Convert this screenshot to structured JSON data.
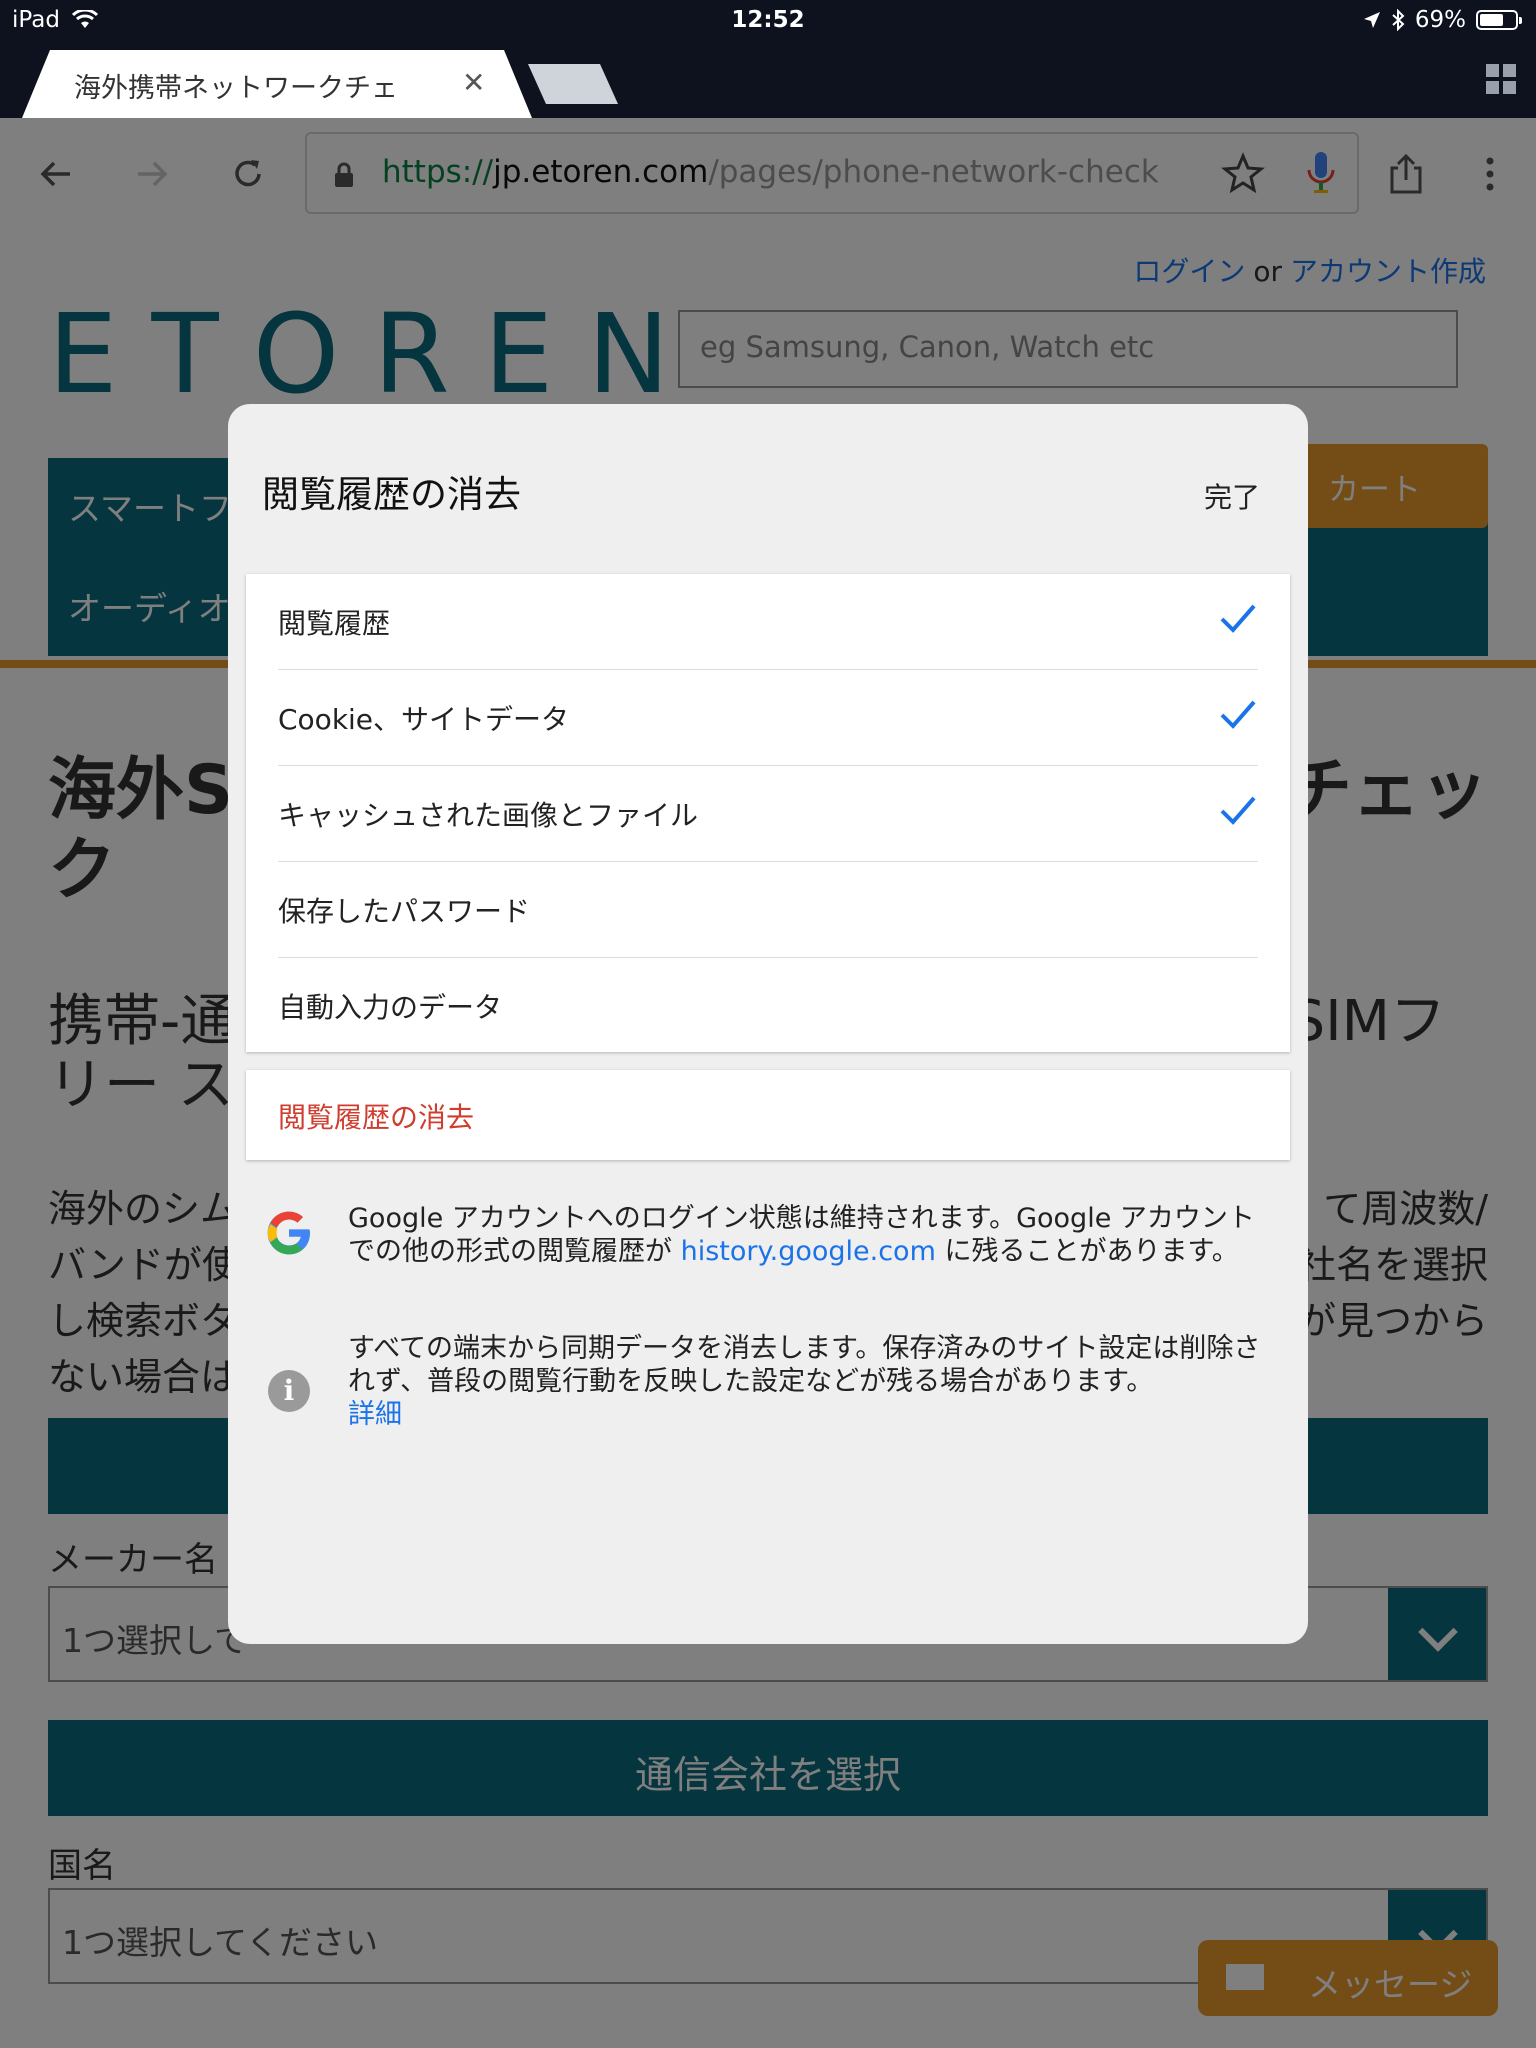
{
  "status_bar": {
    "device": "iPad",
    "time": "12:52",
    "battery": "69%",
    "battery_level": 0.69
  },
  "tab": {
    "title": "海外携帯ネットワークチェ",
    "close_glyph": "✕"
  },
  "toolbar": {
    "url_scheme": "https://",
    "url_host": "jp.etoren.com",
    "url_path": "/pages/phone-network-check"
  },
  "page": {
    "login": "ログイン",
    "or": "or",
    "create_account": "アカウント作成",
    "logo": "ETOREN",
    "search_placeholder": "eg Samsung, Canon, Watch etc",
    "nav_item_1": "スマートフ",
    "nav_item_2": "オーディオ",
    "cart": "カート",
    "heading_left": "海外S",
    "heading_right": "チェッ",
    "heading_line2": "ク",
    "subheading_left": "携帯-通",
    "subheading_right": "SIMフ",
    "subheading_line2": "リー ス",
    "body_lines_left": [
      "海外のシム",
      "バンドが使",
      "し検索ボタ",
      "ない場合は"
    ],
    "body_lines_right": [
      "て周波数/",
      "社名を選択",
      "が見つから"
    ],
    "maker_label": "メーカー名",
    "maker_select": "1つ選択して",
    "carrier_button": "通信会社を選択",
    "country_label": "国名",
    "country_select": "1つ選択してください",
    "message_button": "メッセージ"
  },
  "dialog": {
    "title": "閲覧履歴の消去",
    "done": "完了",
    "options": [
      {
        "label": "閲覧履歴",
        "checked": true
      },
      {
        "label": "Cookie、サイトデータ",
        "checked": true
      },
      {
        "label": "キャッシュされた画像とファイル",
        "checked": true
      },
      {
        "label": "保存したパスワード",
        "checked": false
      },
      {
        "label": "自動入力のデータ",
        "checked": false
      }
    ],
    "clear_button": "閲覧履歴の消去",
    "google_note_before": "Google アカウントへのログイン状態は維持されます。Google アカウントでの他の形式の閲覧履歴が ",
    "google_note_link": "history.google.com",
    "google_note_after": " に残ることがあります。",
    "sync_note": "すべての端末から同期データを消去します。保存済みのサイト設定は削除されず、普段の閲覧行動を反映した設定などが残る場合があります。",
    "details_link": "詳細",
    "info_glyph": "i"
  },
  "colors": {
    "accent_blue": "#1a73e8",
    "destructive_red": "#d03d2e",
    "site_teal": "#0b6a7f",
    "site_orange": "#e89a2c"
  },
  "icons": [
    "wifi-icon",
    "location-icon",
    "bluetooth-icon",
    "battery-icon",
    "back-icon",
    "forward-icon",
    "reload-icon",
    "lock-icon",
    "star-icon",
    "mic-icon",
    "share-icon",
    "menu-icon",
    "tab-switcher-icon",
    "checkmark-icon",
    "google-g-icon",
    "info-icon"
  ]
}
